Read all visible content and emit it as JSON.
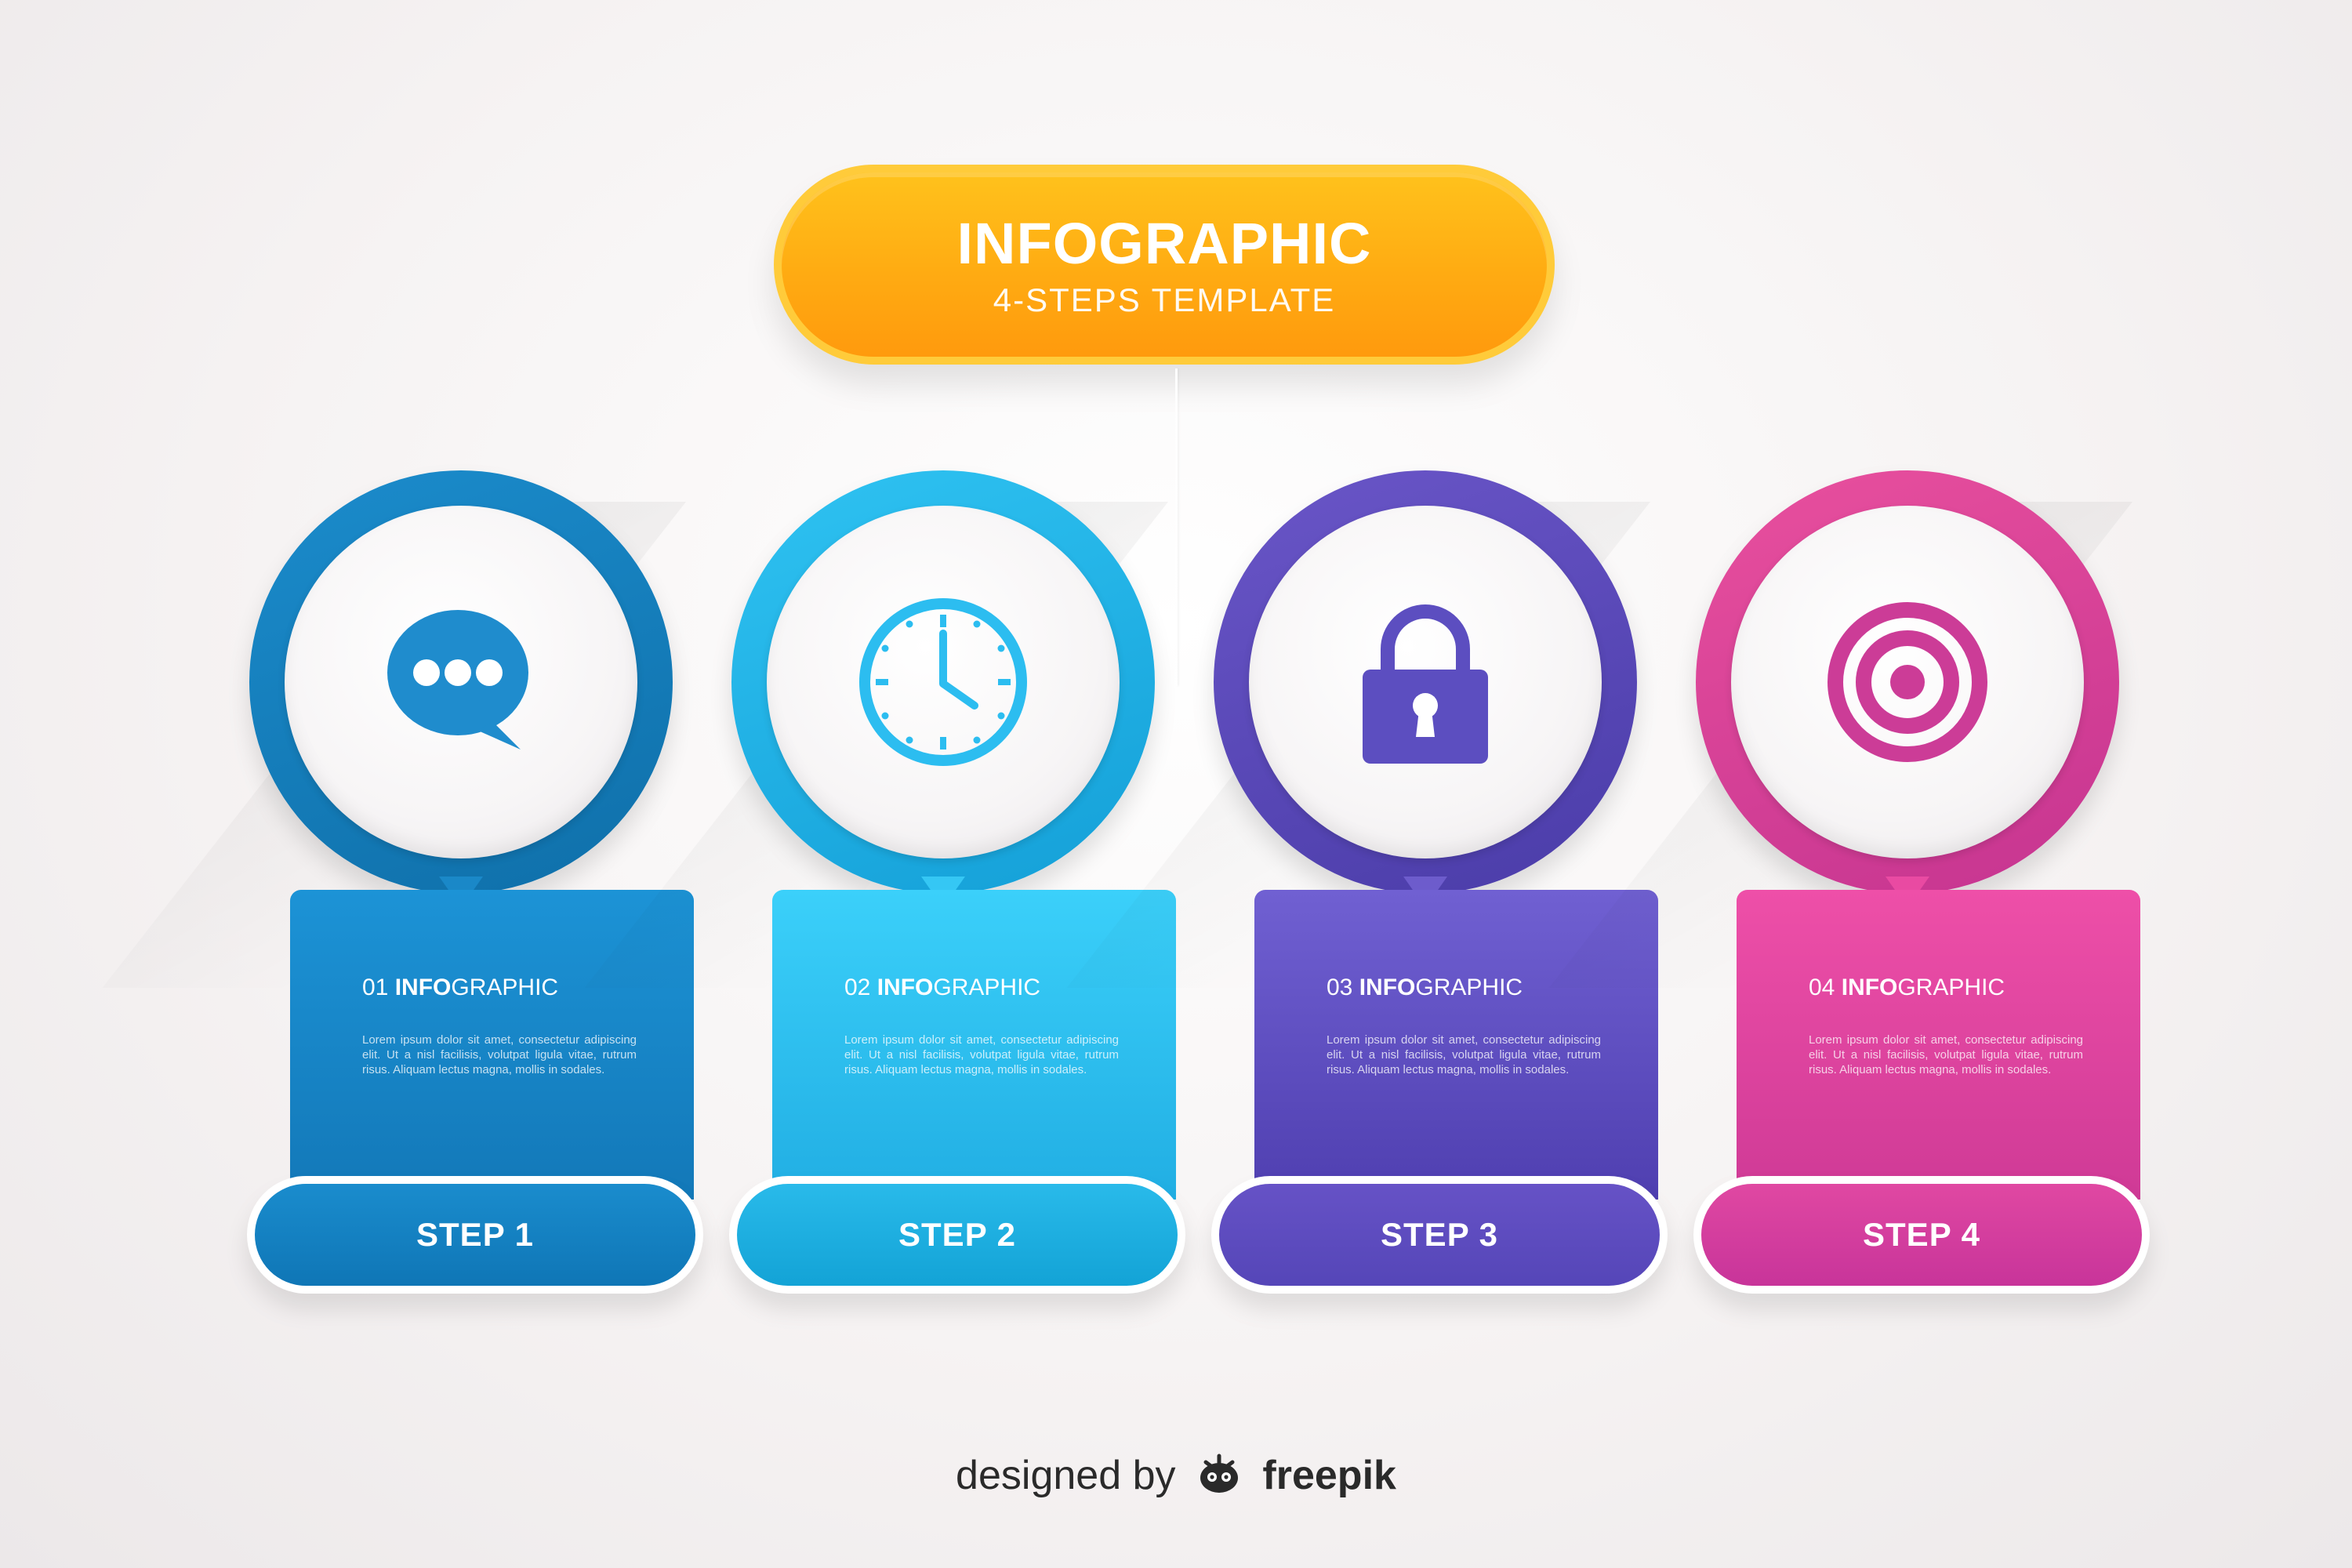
{
  "header": {
    "title": "INFOGRAPHIC",
    "subtitle": "4-STEPS TEMPLATE"
  },
  "steps": [
    {
      "number": "01",
      "title_bold": "INFO",
      "title_rest": "GRAPHIC",
      "body": "Lorem ipsum dolor sit amet, consectetur adipiscing elit. Ut a nisl facilisis, volutpat ligula vitae, rutrum risus. Aliquam lectus magna, mollis in sodales.",
      "button": "STEP 1",
      "icon": "speech-bubble-icon",
      "color": "#1a8ccd"
    },
    {
      "number": "02",
      "title_bold": "INFO",
      "title_rest": "GRAPHIC",
      "body": "Lorem ipsum dolor sit amet, consectetur adipiscing elit. Ut a nisl facilisis, volutpat ligula vitae, rutrum risus. Aliquam lectus magna, mollis in sodales.",
      "button": "STEP 2",
      "icon": "clock-icon",
      "color": "#29baea"
    },
    {
      "number": "03",
      "title_bold": "INFO",
      "title_rest": "GRAPHIC",
      "body": "Lorem ipsum dolor sit amet, consectetur adipiscing elit. Ut a nisl facilisis, volutpat ligula vitae, rutrum risus. Aliquam lectus magna, mollis in sodales.",
      "button": "STEP 3",
      "icon": "padlock-icon",
      "color": "#6652c6"
    },
    {
      "number": "04",
      "title_bold": "INFO",
      "title_rest": "GRAPHIC",
      "body": "Lorem ipsum dolor sit amet, consectetur adipiscing elit. Ut a nisl facilisis, volutpat ligula vitae, rutrum risus. Aliquam lectus magna, mollis in sodales.",
      "button": "STEP 4",
      "icon": "target-icon",
      "color": "#e048a2"
    }
  ],
  "footer": {
    "prefix": "designed by",
    "brand": "freepik"
  },
  "colors": {
    "title_accent": "#ffab12",
    "step1": "#1a8ccd",
    "step2": "#29baea",
    "step3": "#6652c6",
    "step4": "#e048a2"
  }
}
